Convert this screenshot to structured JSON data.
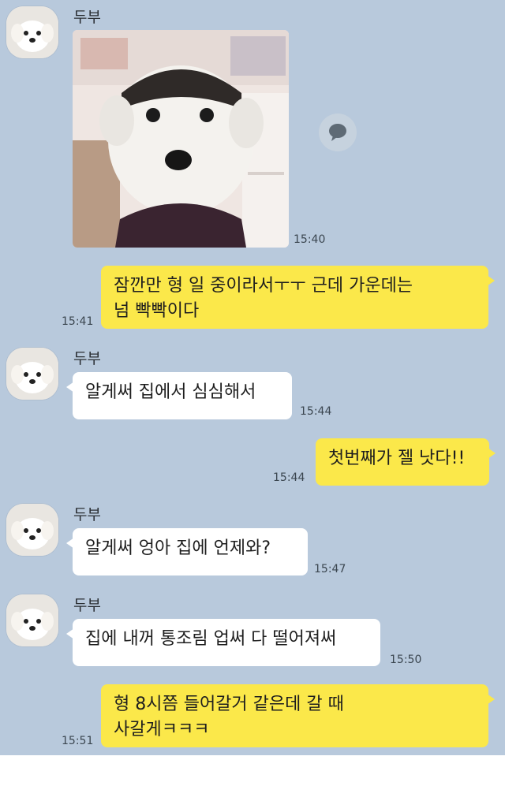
{
  "sender_name": "두부",
  "image_message": {
    "time": "15:40",
    "share_icon": "speech-bubble-icon"
  },
  "messages": [
    {
      "from": "me",
      "text": "잠깐만 형 일 중이라서ㅜㅜ 근데 가운데는\n넘 빡빡이다",
      "time": "15:41"
    },
    {
      "from": "them",
      "text": "알게써 집에서 심심해서",
      "time": "15:44"
    },
    {
      "from": "me",
      "text": "첫번째가 젤 낫다!!",
      "time": "15:44"
    },
    {
      "from": "them",
      "text": "알게써 엉아 집에 언제와?",
      "time": "15:47"
    },
    {
      "from": "them",
      "text": "집에 내꺼 통조림 업써 다 떨어져써",
      "time": "15:50"
    },
    {
      "from": "me",
      "text": "형 8시쯤 들어갈거 같은데 갈 때\n사갈게ㅋㅋㅋ",
      "time": "15:51"
    }
  ],
  "colors": {
    "chat_bg": "#b8c9dc",
    "my_bubble": "#fbe84a",
    "their_bubble": "#ffffff"
  }
}
